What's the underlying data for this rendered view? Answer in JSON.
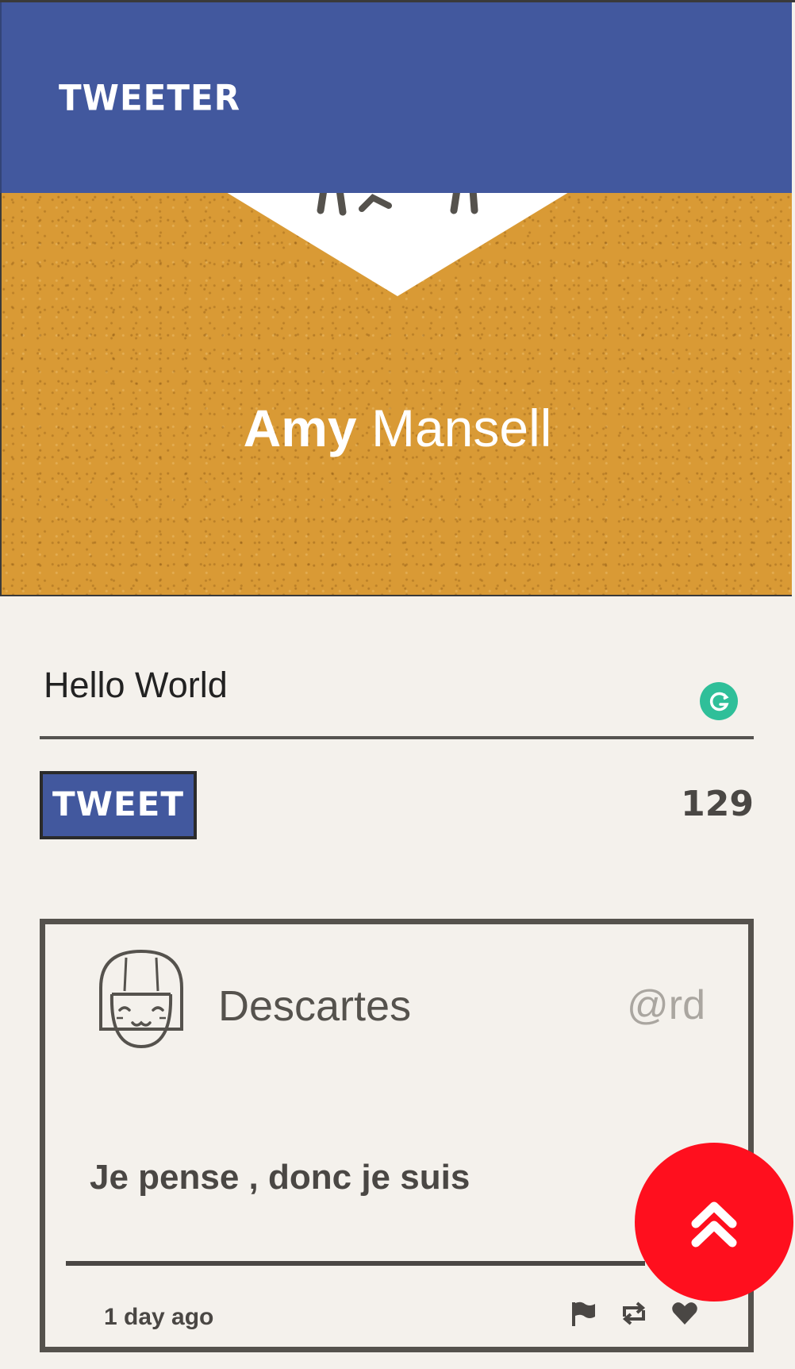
{
  "header": {
    "logo_text": "TWEETER",
    "background_color": "#42589e"
  },
  "profile": {
    "first_name": "Amy",
    "last_name": "Mansell",
    "banner_color": "#d99a35",
    "avatar_icon": "avatar-face-icon"
  },
  "compose": {
    "text": "Hello World",
    "grammarly_icon": "grammarly-icon",
    "tweet_button_label": "TWEET",
    "char_count": "129"
  },
  "tweet": {
    "author": "Descartes",
    "handle": "@rd",
    "avatar_icon": "girl-avatar-icon",
    "body": "Je pense , donc je suis",
    "time": "1 day ago",
    "actions": [
      "flag-icon",
      "retweet-icon",
      "heart-icon"
    ]
  },
  "scroll_top": {
    "icon": "double-chevron-up-icon",
    "color": "#ff0f1e"
  }
}
